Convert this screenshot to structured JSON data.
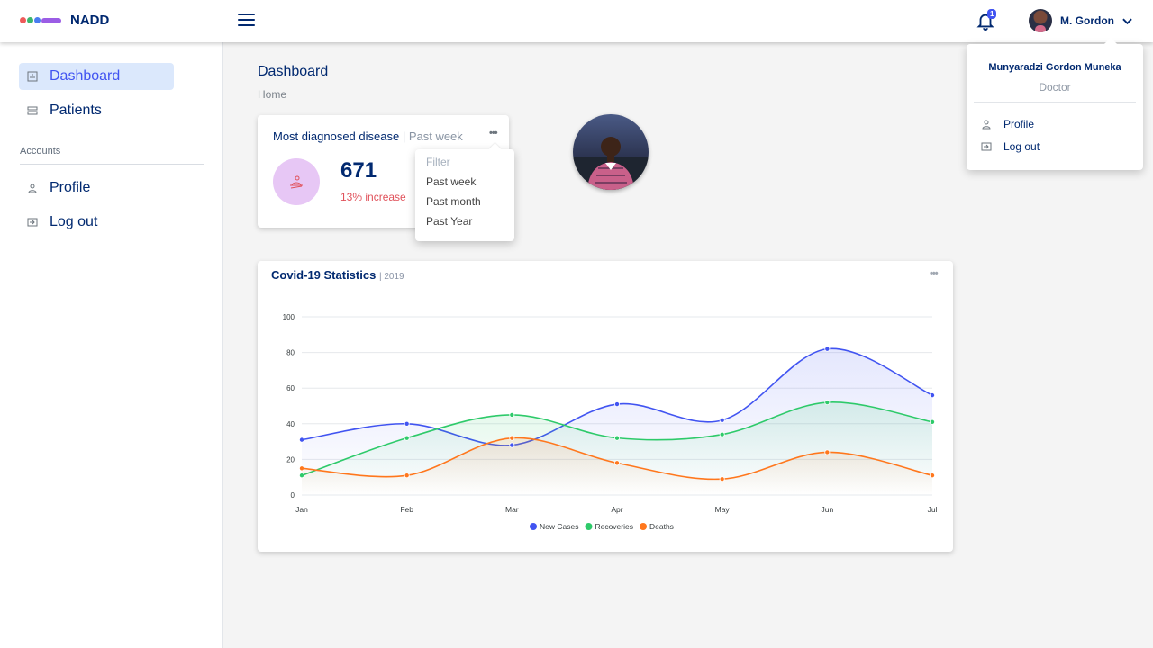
{
  "brand": {
    "name": "NADD",
    "colors": [
      "#ee5a5a",
      "#3bb56d",
      "#4a7cf0",
      "#9b5de5"
    ]
  },
  "header": {
    "notification_count": "1",
    "user_short_name": "M. Gordon"
  },
  "sidebar": {
    "items": [
      {
        "label": "Dashboard",
        "icon": "dashboard-icon",
        "active": true
      },
      {
        "label": "Patients",
        "icon": "layers-icon"
      }
    ],
    "accounts_heading": "Accounts",
    "account_items": [
      {
        "label": "Profile",
        "icon": "person-icon"
      },
      {
        "label": "Log out",
        "icon": "logout-icon"
      }
    ]
  },
  "page": {
    "title": "Dashboard",
    "breadcrumb": "Home"
  },
  "disease_card": {
    "title": "Most diagnosed disease",
    "period": "| Past week",
    "value": "671",
    "change": "13% increase",
    "menu": {
      "header": "Filter",
      "options": [
        "Past week",
        "Past month",
        "Past Year"
      ]
    }
  },
  "profile_menu": {
    "full_name": "Munyaradzi Gordon Muneka",
    "role": "Doctor",
    "items": [
      "Profile",
      "Log out"
    ]
  },
  "stats_card": {
    "title": "Covid-19 Statistics",
    "year": "| 2019"
  },
  "chart_data": {
    "type": "area",
    "categories": [
      "Jan",
      "Feb",
      "Mar",
      "Apr",
      "May",
      "Jun",
      "Jul"
    ],
    "series": [
      {
        "name": "New Cases",
        "color": "#4154f1",
        "values": [
          31,
          40,
          28,
          51,
          42,
          82,
          56
        ]
      },
      {
        "name": "Recoveries",
        "color": "#2eca6a",
        "values": [
          11,
          32,
          45,
          32,
          34,
          52,
          41
        ]
      },
      {
        "name": "Deaths",
        "color": "#ff771d",
        "values": [
          15,
          11,
          32,
          18,
          9,
          24,
          11
        ]
      }
    ],
    "ylim": [
      0,
      100
    ],
    "yticks": [
      "0",
      "20",
      "40",
      "60",
      "80",
      "100"
    ],
    "grid": true,
    "legend": "bottom"
  }
}
